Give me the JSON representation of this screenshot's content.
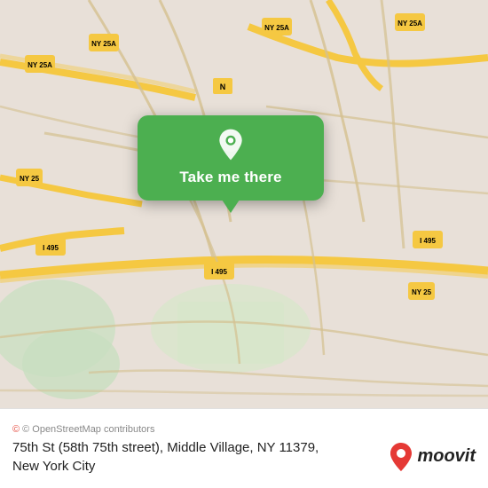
{
  "map": {
    "alt": "Map of Middle Village, NY",
    "popup": {
      "button_label": "Take me there"
    }
  },
  "bottom_bar": {
    "attribution": "© OpenStreetMap contributors",
    "address_line1": "75th St (58th 75th street), Middle Village, NY 11379,",
    "address_line2": "New York City",
    "moovit_label": "moovit"
  },
  "icons": {
    "pin": "📍",
    "osm_circle": "©",
    "moovit_pin": "📍"
  }
}
